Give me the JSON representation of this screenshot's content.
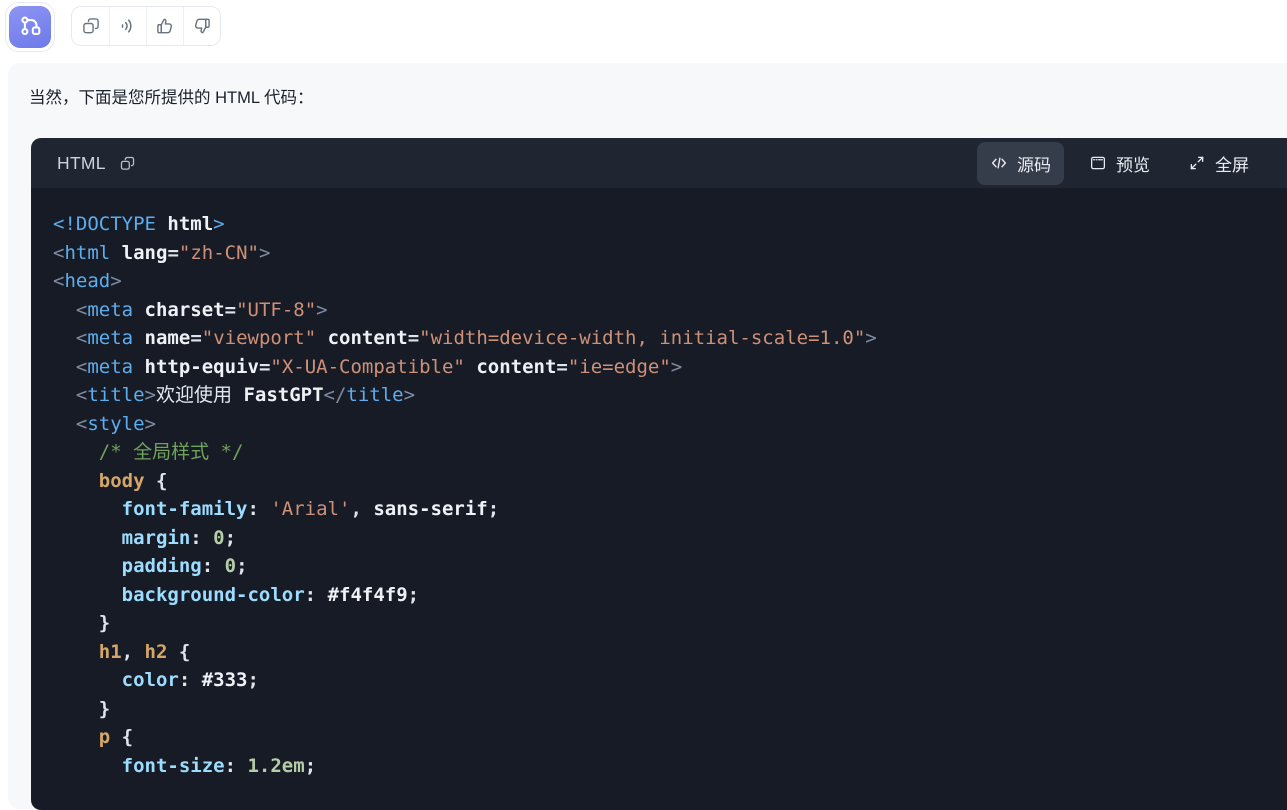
{
  "assistant_header": {
    "avatar": {
      "icon": "workflow-icon",
      "background": "#7c85ee"
    },
    "actions": [
      {
        "name": "copy-message",
        "icon": "copy-icon"
      },
      {
        "name": "read-aloud",
        "icon": "voice-icon"
      },
      {
        "name": "good-feedback",
        "icon": "thumbs-up-icon"
      },
      {
        "name": "bad-feedback",
        "icon": "thumbs-down-icon"
      }
    ]
  },
  "message": {
    "text": "当然，下面是您所提供的 HTML 代码："
  },
  "bubble": {
    "background": "#f7f8fa"
  },
  "code_block": {
    "language_label": "HTML",
    "copy_icon": "copy-icon",
    "toolbar": [
      {
        "id": "source",
        "label": "源码",
        "icon": "code-icon",
        "active": true
      },
      {
        "id": "preview",
        "label": "预览",
        "icon": "window-icon",
        "active": false
      },
      {
        "id": "fullscreen",
        "label": "全屏",
        "icon": "expand-icon",
        "active": false
      }
    ],
    "colors": {
      "header_bg": "#1f2632",
      "body_bg": "#171b25",
      "active_button_bg": "#353c4a",
      "tokens": {
        "punct": "#7e8ca3",
        "tag": "#5caeef",
        "attr": "#eef1f6",
        "string": "#ce9178",
        "comment": "#71a25c",
        "selector": "#d4a668",
        "property": "#9cdcfe",
        "number": "#b5cea8",
        "value": "#eef1f6",
        "text": "#dfe3ea",
        "plain": "#e3e7ee"
      }
    },
    "lines": [
      [
        [
          "tag",
          "<!DOCTYPE "
        ],
        [
          "value",
          "html"
        ],
        [
          "tag",
          ">"
        ]
      ],
      [
        [
          "punct",
          "<"
        ],
        [
          "tag",
          "html"
        ],
        [
          "text",
          " "
        ],
        [
          "attr",
          "lang"
        ],
        [
          "text",
          "="
        ],
        [
          "string",
          "\"zh-CN\""
        ],
        [
          "punct",
          ">"
        ]
      ],
      [
        [
          "punct",
          "<"
        ],
        [
          "tag",
          "head"
        ],
        [
          "punct",
          ">"
        ]
      ],
      [
        [
          "punct",
          "  <"
        ],
        [
          "tag",
          "meta"
        ],
        [
          "text",
          " "
        ],
        [
          "attr",
          "charset"
        ],
        [
          "text",
          "="
        ],
        [
          "string",
          "\"UTF-8\""
        ],
        [
          "punct",
          ">"
        ]
      ],
      [
        [
          "punct",
          "  <"
        ],
        [
          "tag",
          "meta"
        ],
        [
          "text",
          " "
        ],
        [
          "attr",
          "name"
        ],
        [
          "text",
          "="
        ],
        [
          "string",
          "\"viewport\""
        ],
        [
          "text",
          " "
        ],
        [
          "attr",
          "content"
        ],
        [
          "text",
          "="
        ],
        [
          "string",
          "\"width=device-width, initial-scale=1.0\""
        ],
        [
          "punct",
          ">"
        ]
      ],
      [
        [
          "punct",
          "  <"
        ],
        [
          "tag",
          "meta"
        ],
        [
          "text",
          " "
        ],
        [
          "attr",
          "http-equiv"
        ],
        [
          "text",
          "="
        ],
        [
          "string",
          "\"X-UA-Compatible\""
        ],
        [
          "text",
          " "
        ],
        [
          "attr",
          "content"
        ],
        [
          "text",
          "="
        ],
        [
          "string",
          "\"ie=edge\""
        ],
        [
          "punct",
          ">"
        ]
      ],
      [
        [
          "punct",
          "  <"
        ],
        [
          "tag",
          "title"
        ],
        [
          "punct",
          ">"
        ],
        [
          "plain",
          "欢迎使用 "
        ],
        [
          "value",
          "FastGPT"
        ],
        [
          "punct",
          "</"
        ],
        [
          "tag",
          "title"
        ],
        [
          "punct",
          ">"
        ]
      ],
      [
        [
          "punct",
          "  <"
        ],
        [
          "tag",
          "style"
        ],
        [
          "punct",
          ">"
        ]
      ],
      [
        [
          "comment",
          "    /* 全局样式 */"
        ]
      ],
      [
        [
          "selector",
          "    body"
        ],
        [
          "text",
          " {"
        ]
      ],
      [
        [
          "property",
          "      font-family"
        ],
        [
          "text",
          ": "
        ],
        [
          "string",
          "'Arial'"
        ],
        [
          "text",
          ", "
        ],
        [
          "value",
          "sans-serif"
        ],
        [
          "text",
          ";"
        ]
      ],
      [
        [
          "property",
          "      margin"
        ],
        [
          "text",
          ": "
        ],
        [
          "number",
          "0"
        ],
        [
          "text",
          ";"
        ]
      ],
      [
        [
          "property",
          "      padding"
        ],
        [
          "text",
          ": "
        ],
        [
          "number",
          "0"
        ],
        [
          "text",
          ";"
        ]
      ],
      [
        [
          "property",
          "      background-color"
        ],
        [
          "text",
          ": "
        ],
        [
          "value",
          "#f4f4f9"
        ],
        [
          "text",
          ";"
        ]
      ],
      [
        [
          "text",
          "    }"
        ]
      ],
      [
        [
          "selector",
          "    h1"
        ],
        [
          "text",
          ", "
        ],
        [
          "selector",
          "h2"
        ],
        [
          "text",
          " {"
        ]
      ],
      [
        [
          "property",
          "      color"
        ],
        [
          "text",
          ": "
        ],
        [
          "value",
          "#333"
        ],
        [
          "text",
          ";"
        ]
      ],
      [
        [
          "text",
          "    }"
        ]
      ],
      [
        [
          "selector",
          "    p"
        ],
        [
          "text",
          " {"
        ]
      ],
      [
        [
          "property",
          "      font-size"
        ],
        [
          "text",
          ": "
        ],
        [
          "number",
          "1.2em"
        ],
        [
          "text",
          ";"
        ]
      ]
    ]
  }
}
